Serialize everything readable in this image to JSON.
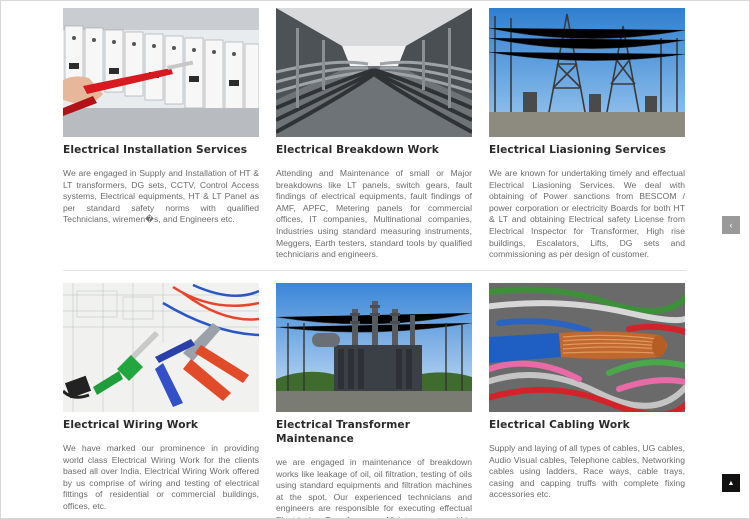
{
  "services": [
    {
      "title": "Electrical Installation Services",
      "image": "switchgear-panel-photo",
      "text": "We are engaged in Supply and Installation of HT & LT transformers, DG sets, CCTV, Control Access systems, Electrical equipments, HT & LT Panel as per standard safety norms with qualified Technicians, wiremen�s, and Engineers etc."
    },
    {
      "title": "Electrical Breakdown Work",
      "image": "cable-tray-corridor-photo",
      "text": "Attending and Maintenance of small or Major breakdowns like LT panels, switch gears, fault findings of electrical equipments, fault findings of AMF, APFC, Metering panels for commercial offices, IT companies, Multinational companies, Industries using standard measuring instruments, Meggers, Earth testers, standard tools by qualified technicians and engineers."
    },
    {
      "title": "Electrical Liasioning Services",
      "image": "substation-photo",
      "text": "We are known for undertaking timely and effectual Electrical Liasioning Services. We deal with obtaining of Power sanctions from BESCOM / power corporation or electricity Boards for both HT & LT and obtaining Electrical safety License from Electrical Inspector for Transformer, High rise buildings, Escalators, Lifts, DG sets and commissioning as per design of customer."
    },
    {
      "title": "Electrical Wiring Work",
      "image": "wiring-tools-blueprint-photo",
      "text": "We have marked our prominence in providing world class Electrical Wiring Work for the clients based all over India. Electrical Wiring Work offered by us comprise of wiring and testing of electrical fittings of residential or commercial buildings, offices, etc."
    },
    {
      "title": "Electrical Transformer Maintenance",
      "image": "transformer-photo",
      "text": "we are engaged in maintenance of breakdown works like leakage of oil, oil filtration, testing of oils using standard equipments and filtration machines at the spot. Our experienced technicians and engineers are responsible for executing effectual Electrical Transformer Maintenance within prescribed time."
    },
    {
      "title": "Electrical Cabling Work",
      "image": "copper-cables-photo",
      "text": "Supply and laying of all types of cables, UG cables, Audio Visual cables, Telephone cables, Networking cables using ladders, Race ways, cable trays, casing and capping truffs with complete fixing accessories etc."
    }
  ],
  "controls": {
    "side_icon": "chevron-left-icon",
    "side_glyph": "‹",
    "top_icon": "chevron-up-icon",
    "top_glyph": "▲"
  }
}
